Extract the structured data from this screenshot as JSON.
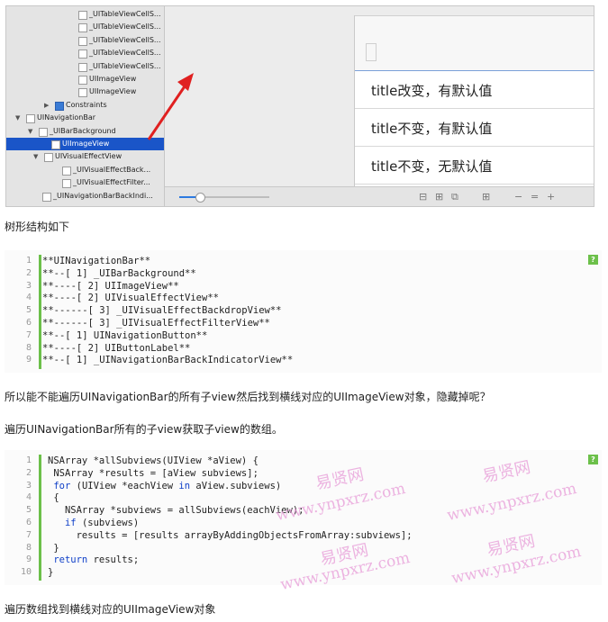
{
  "tree": {
    "rows": [
      {
        "label": "_UITableViewCellS...",
        "indent": 0,
        "has_tri": false,
        "icon": "box"
      },
      {
        "label": "_UITableViewCellS...",
        "indent": 0,
        "has_tri": false,
        "icon": "box"
      },
      {
        "label": "_UITableViewCellS...",
        "indent": 0,
        "has_tri": false,
        "icon": "box"
      },
      {
        "label": "_UITableViewCellS...",
        "indent": 0,
        "has_tri": false,
        "icon": "box"
      },
      {
        "label": "_UITableViewCellS...",
        "indent": 0,
        "has_tri": false,
        "icon": "box"
      },
      {
        "label": "UIImageView",
        "indent": 0,
        "has_tri": false,
        "icon": "box"
      },
      {
        "label": "UIImageView",
        "indent": 0,
        "has_tri": false,
        "icon": "box"
      },
      {
        "label": "Constraints",
        "indent": 0,
        "has_tri": true,
        "icon": "blue"
      },
      {
        "label": "UINavigationBar",
        "indent": 0,
        "has_tri": true,
        "icon": "box"
      },
      {
        "label": "_UIBarBackground",
        "indent": 0,
        "has_tri": true,
        "icon": "box"
      },
      {
        "label": "UIImageView",
        "indent": 0,
        "has_tri": false,
        "icon": "box",
        "selected": true
      },
      {
        "label": "UIVisualEffectView",
        "indent": 0,
        "has_tri": true,
        "icon": "box"
      },
      {
        "label": "_UIVisualEffectBack...",
        "indent": 0,
        "has_tri": false,
        "icon": "box"
      },
      {
        "label": "_UIVisualEffectFilter...",
        "indent": 0,
        "has_tri": false,
        "icon": "box"
      },
      {
        "label": "_UINavigationBarBackIndi...",
        "indent": 0,
        "has_tri": false,
        "icon": "box"
      }
    ]
  },
  "preview": {
    "cells": [
      "title改变，有默认值",
      "title不变，有默认值",
      "title不变，无默认值"
    ]
  },
  "toolbar": {
    "icons": [
      "⊟",
      "⊞",
      "⧉",
      "⊞",
      "−",
      "=",
      "+"
    ]
  },
  "text": {
    "tree_caption": "树形结构如下",
    "question": "所以能不能遍历UINavigationBar的所有子view然后找到横线对应的UIImageView对象，隐藏掉呢？",
    "traverse_caption": "遍历UINavigationBar所有的子view获取子view的数组。",
    "last_caption": "遍历数组找到横线对应的UIImageView对象"
  },
  "code1": {
    "lines": [
      "**UINavigationBar**",
      "**--[ 1] _UIBarBackground**",
      "**----[ 2] UIImageView**",
      "**----[ 2] UIVisualEffectView**",
      "**------[ 3] _UIVisualEffectBackdropView**",
      "**------[ 3] _UIVisualEffectFilterView**",
      "**--[ 1] UINavigationButton**",
      "**----[ 2] UIButtonLabel**",
      "**--[ 1] _UINavigationBarBackIndicatorView**"
    ]
  },
  "code2": {
    "lines": [
      "NSArray *allSubviews(UIView *aView) {",
      " NSArray *results = [aView subviews];",
      " for (UIView *eachView in aView.subviews)",
      " {",
      "   NSArray *subviews = allSubviews(eachView);",
      "   if (subviews)",
      "     results = [results arrayByAddingObjectsFromArray:subviews];",
      " }",
      " return results;",
      "}"
    ]
  },
  "help_label": "?",
  "watermark": {
    "cn": "易贤网",
    "url": "www.ynpxrz.com"
  },
  "colors": {
    "selection": "#1a55c8",
    "arrow": "#e02020",
    "code_bar": "#6cc04a",
    "watermark": "#e79bd8"
  }
}
